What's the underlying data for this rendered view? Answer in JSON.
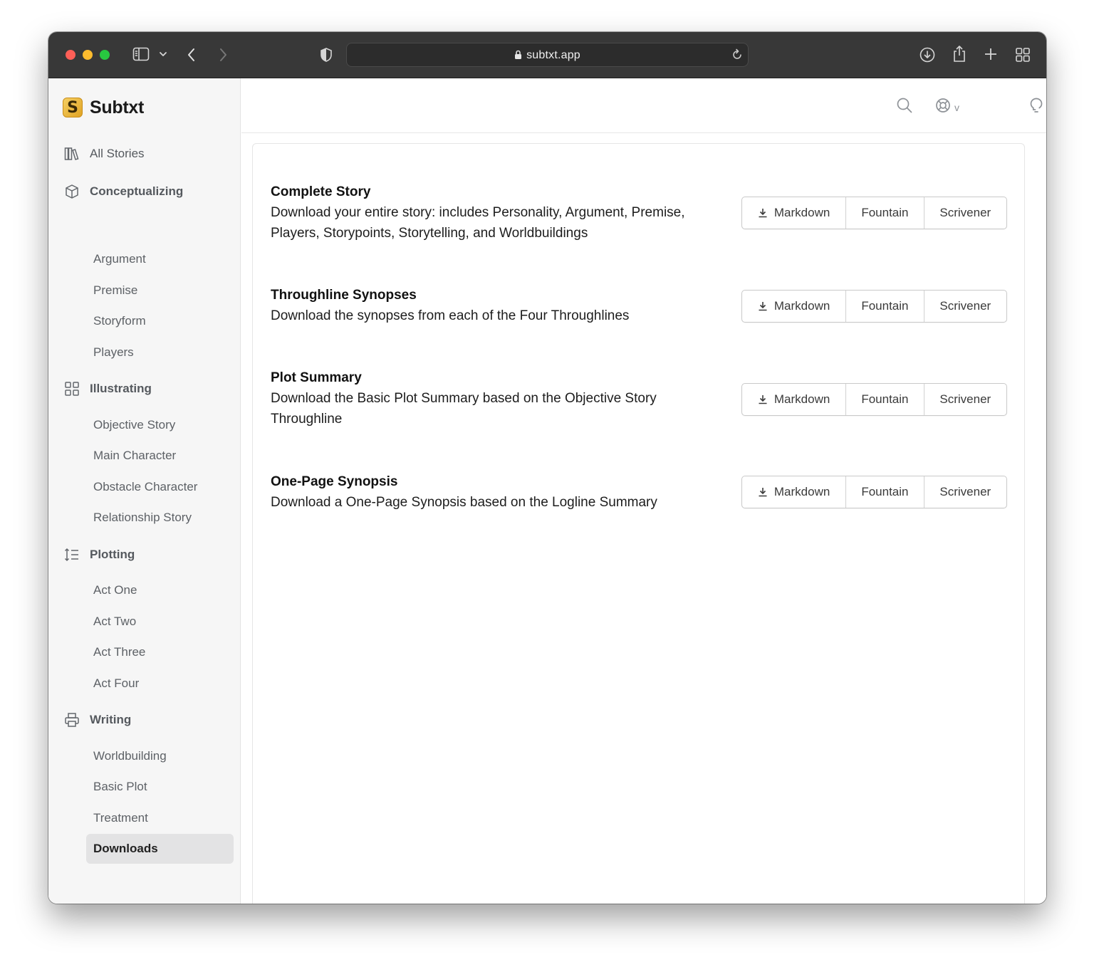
{
  "browser": {
    "url": "subtxt.app",
    "icons": [
      "sidebar-icon",
      "chevron-down-icon",
      "back-icon",
      "forward-icon",
      "shield-icon",
      "lock-icon",
      "reload-icon",
      "download-icon",
      "share-icon",
      "plus-icon",
      "tabs-grid-icon"
    ]
  },
  "brand": {
    "logo_letter": "S",
    "name": "Subtxt",
    "accent": "#e8b53a"
  },
  "sidebar": {
    "all_stories": "All Stories",
    "sections": [
      {
        "label": "Conceptualizing",
        "icon": "cube-icon",
        "items": [
          "Argument",
          "Premise",
          "Storyform",
          "Players"
        ]
      },
      {
        "label": "Illustrating",
        "icon": "grid-icon",
        "items": [
          "Objective Story",
          "Main Character",
          "Obstacle Character",
          "Relationship Story"
        ]
      },
      {
        "label": "Plotting",
        "icon": "ordered-list-icon",
        "items": [
          "Act One",
          "Act Two",
          "Act Three",
          "Act Four"
        ]
      },
      {
        "label": "Writing",
        "icon": "printer-icon",
        "items": [
          "Worldbuilding",
          "Basic Plot",
          "Treatment",
          "Downloads"
        ]
      }
    ],
    "active_item": "Downloads"
  },
  "topbar": {
    "icons": [
      "search-icon",
      "help-icon",
      "chevron-down-icon",
      "idea-icon",
      "menu-icon"
    ],
    "help_suffix": "v"
  },
  "downloads": {
    "buttons": {
      "markdown": "Markdown",
      "fountain": "Fountain",
      "scrivener": "Scrivener"
    },
    "sections": [
      {
        "title": "Complete Story",
        "description": "Download your entire story: includes Personality, Argument, Premise, Players, Storypoints, Storytelling, and Worldbuildings"
      },
      {
        "title": "Throughline Synopses",
        "description": "Download the synopses from each of the Four Throughlines"
      },
      {
        "title": "Plot Summary",
        "description": "Download the Basic Plot Summary based on the Objective Story Throughline"
      },
      {
        "title": "One-Page Synopsis",
        "description": "Download a One-Page Synopsis based on the Logline Summary"
      }
    ]
  }
}
